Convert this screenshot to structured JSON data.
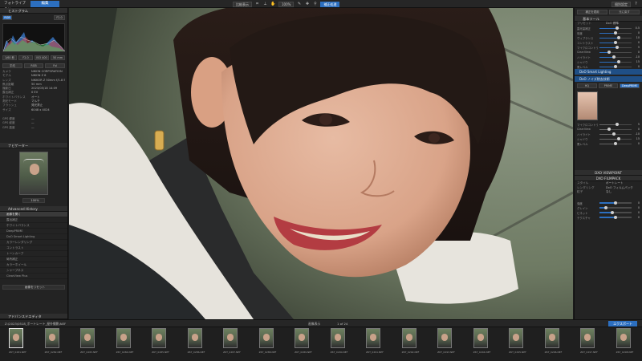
{
  "topbar": {
    "tab_library": "フォトライブラリ",
    "tab_edit": "編集",
    "tools": [
      "比較表示",
      "100%",
      "補正処理"
    ],
    "right_label": "個別設定"
  },
  "left": {
    "histogram_header": "ヒストグラム",
    "histogram_btn": "RGB",
    "histogram_val": "F2.0",
    "exposure_row": [
      "1/60 秒",
      "F2.0",
      "ISO 400",
      "50 mm"
    ],
    "btn_row2": [
      "平均",
      "RGB",
      "Ful"
    ],
    "info_rows": [
      {
        "k": "カメラ",
        "v": "NIKON CORPORATION"
      },
      {
        "k": "モデル",
        "v": "NIKON Z 6"
      },
      {
        "k": "レンズ",
        "v": "NIKKOR Z 50mm f/1.8 S"
      },
      {
        "k": "焦点距離",
        "v": "50 mm"
      },
      {
        "k": "撮影日",
        "v": "2023/05/18 14:09"
      },
      {
        "k": "露出補正",
        "v": "0 EV"
      },
      {
        "k": "ホワイトバランス",
        "v": "オート"
      },
      {
        "k": "測光モード",
        "v": "マルチ"
      },
      {
        "k": "フラッシュ",
        "v": "発光禁止"
      },
      {
        "k": "サイズ",
        "v": "6048 x 4024"
      }
    ],
    "gps_rows": [
      {
        "k": "GPS 緯度",
        "v": "—"
      },
      {
        "k": "GPS 経度",
        "v": "—"
      },
      {
        "k": "GPS 高度",
        "v": "—"
      }
    ],
    "nav_header": "ナビゲーター",
    "nav_zoom": "100%",
    "history_header": "Advanced History",
    "history_items": [
      "画像を開く",
      "露出補正",
      "ホワイトバランス",
      "DeepPRIME",
      "DxO Smart Lighting",
      "カラーレンダリング",
      "コントラスト",
      "トーンカーブ",
      "局所補正",
      "カラーホイール",
      "シャープネス",
      "ClearView Plus"
    ],
    "history_footer": "画像をリセット",
    "bottom_label": "アドバンスドエディタ"
  },
  "right": {
    "top_buttons": [
      "補正を適用",
      "元に戻す"
    ],
    "header_basic": "基本ツール",
    "preset_label": "プリセット",
    "preset_value": "DxO 標準",
    "header_light": "DxO Smart Lighting",
    "header_noise": "DxO ノイズ除去技術",
    "noise_modes": [
      "HQ",
      "PRIME",
      "DeepPRIME"
    ],
    "sliders": [
      {
        "lbl": "露光量補正",
        "v": 0.55,
        "val": "0.5"
      },
      {
        "lbl": "彩度",
        "v": 0.5,
        "val": "0"
      },
      {
        "lbl": "ヴィブランス",
        "v": 0.6,
        "val": "10"
      },
      {
        "lbl": "コントラスト",
        "v": 0.5,
        "val": "0"
      },
      {
        "lbl": "マイクロコントラスト",
        "v": 0.55,
        "val": "5"
      },
      {
        "lbl": "ClearView",
        "v": 0.3,
        "val": "0"
      },
      {
        "lbl": "ハイライト",
        "v": 0.45,
        "val": "-10"
      },
      {
        "lbl": "シャドウ",
        "v": 0.6,
        "val": "15"
      },
      {
        "lbl": "黒レベル",
        "v": 0.5,
        "val": "0"
      }
    ],
    "viewpoint_header": "DXO VIEWPOINT",
    "filmpack_header": "DXO FILMPACK",
    "film_rows": [
      {
        "lbl": "スタイル",
        "v": "ポートレート"
      },
      {
        "lbl": "レンダリング",
        "v": "DxO フィルムパック"
      },
      {
        "lbl": "粒子",
        "v": "なし"
      }
    ],
    "bottom_sliders": [
      {
        "lbl": "強度",
        "v": 0.5,
        "val": "0"
      },
      {
        "lbl": "グレイン",
        "v": 0.2,
        "val": "0"
      },
      {
        "lbl": "ビネット",
        "v": 0.4,
        "val": "0"
      },
      {
        "lbl": "テクスチャ",
        "v": 0.5,
        "val": "0"
      }
    ]
  },
  "filmbar": {
    "path": "Z:\\2023\\0518_ポートレート_屋外撮影\\NEF",
    "mid_label": "画像表示",
    "count": "1 of 24",
    "right_btn": "エクスポート"
  },
  "filmstrip": [
    "Z6T_0281.NEF",
    "Z6T_0282.NEF",
    "Z6T_0283.NEF",
    "Z6T_0284.NEF",
    "Z6T_0285.NEF",
    "Z6T_0286.NEF",
    "Z6T_0287.NEF",
    "Z6T_0288.NEF",
    "Z6T_0289.NEF",
    "Z6T_0290.NEF",
    "Z6T_0291.NEF",
    "Z6T_0292.NEF",
    "Z6T_0293.NEF",
    "Z6T_0294.NEF",
    "Z6T_0295.NEF",
    "Z6T_0296.NEF",
    "Z6T_0297.NEF",
    "Z6T_0298.NEF"
  ],
  "colors": {
    "accent": "#2c6fc0",
    "panel": "#232323",
    "background": "#1b1b1b"
  }
}
